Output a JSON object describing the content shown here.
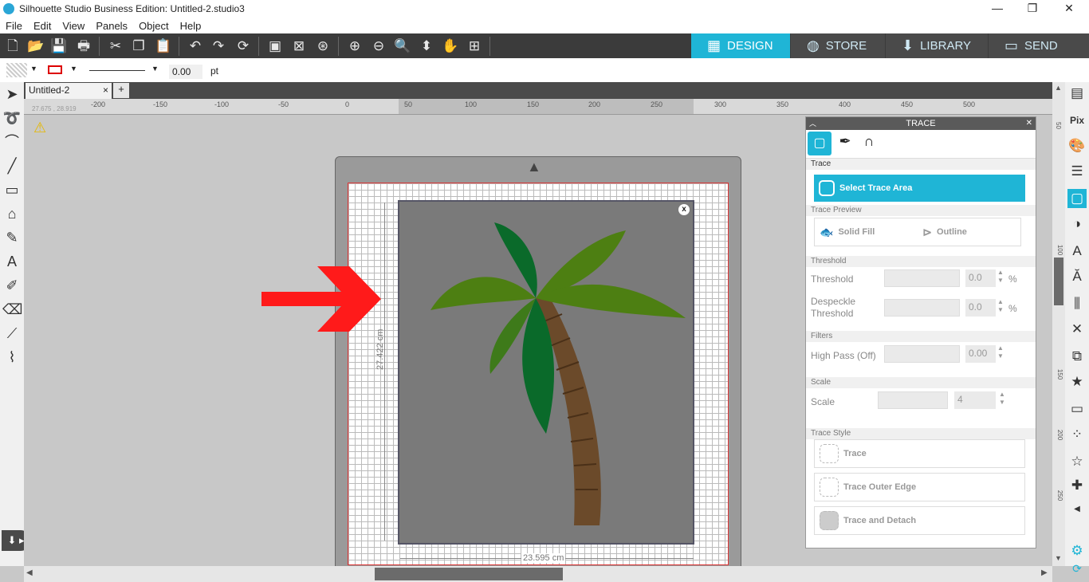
{
  "window": {
    "title": "Silhouette Studio Business Edition: Untitled-2.studio3",
    "min_label": "—",
    "restore_label": "❐",
    "close_label": "✕"
  },
  "menu": [
    "File",
    "Edit",
    "View",
    "Panels",
    "Object",
    "Help"
  ],
  "mode_tabs": [
    {
      "label": "DESIGN",
      "icon": "grid-icon",
      "active": true
    },
    {
      "label": "STORE",
      "icon": "store-icon",
      "active": false
    },
    {
      "label": "LIBRARY",
      "icon": "library-icon",
      "active": false
    },
    {
      "label": "SEND",
      "icon": "send-icon",
      "active": false
    }
  ],
  "line_bar": {
    "line_width_value": "0.00",
    "line_width_unit": "pt"
  },
  "doc_tab": {
    "name": "Untitled-2",
    "close_label": "×",
    "add_label": "+"
  },
  "ruler": {
    "top_labels": [
      "-200",
      "-150",
      "-100",
      "-50",
      "0",
      "50",
      "100",
      "150",
      "200",
      "250",
      "300",
      "350",
      "400",
      "450",
      "500"
    ],
    "coords": "27.675 , 28.919",
    "right_labels": [
      "50",
      "100",
      "150",
      "200",
      "250"
    ]
  },
  "dimensions": {
    "height": "27.422 cm",
    "width": "23.595 cm"
  },
  "trace_panel": {
    "title": "TRACE",
    "close_label": "✕",
    "section_trace": "Trace",
    "select_trace_area": "Select Trace Area",
    "section_preview": "Trace Preview",
    "solid_fill": "Solid Fill",
    "outline": "Outline",
    "section_threshold": "Threshold",
    "threshold_label": "Threshold",
    "threshold_value": "0.0",
    "threshold_unit": "%",
    "despeckle_label_1": "Despeckle",
    "despeckle_label_2": "Threshold",
    "despeckle_value": "0.0",
    "despeckle_unit": "%",
    "section_filters": "Filters",
    "highpass_label": "High Pass (Off)",
    "highpass_value": "0.00",
    "section_scale": "Scale",
    "scale_label": "Scale",
    "scale_value": "4",
    "section_style": "Trace Style",
    "style_trace": "Trace",
    "style_outer": "Trace Outer Edge",
    "style_detach": "Trace and Detach"
  },
  "colors": {
    "accent": "#1fb5d6",
    "arrow": "#ff1a1a",
    "leaf_dark": "#0a6a2a",
    "leaf_light": "#4d7f12",
    "trunk": "#6b4a2a"
  }
}
